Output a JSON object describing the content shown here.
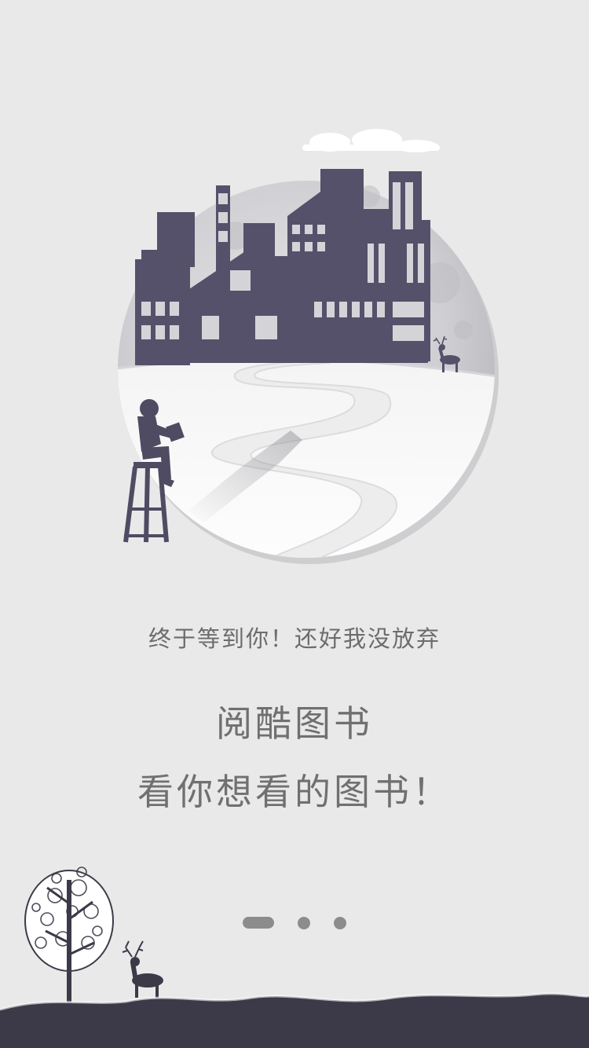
{
  "onboarding": {
    "subtitle": "终于等到你！还好我没放弃",
    "title_line1": "阅酷图书",
    "title_line2": "看你想看的图书！"
  },
  "pager": {
    "total": 3,
    "active_index": 0
  },
  "colors": {
    "background": "#e9e9e9",
    "silhouette": "#55516a",
    "dark_ground": "#3c3a48",
    "text": "#6c6c6c",
    "dot": "#8c8c8c"
  }
}
